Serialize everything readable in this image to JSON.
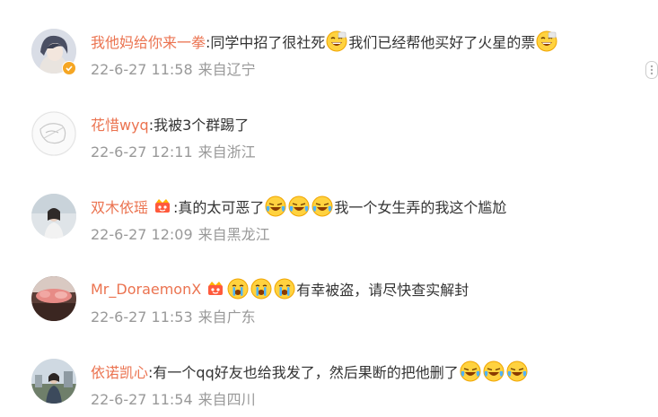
{
  "comments": [
    {
      "username": "我他妈给你来一拳",
      "segments": [
        {
          "type": "text",
          "value": ":同学中招了很社死"
        },
        {
          "type": "emoji",
          "name": "grin-emoji"
        },
        {
          "type": "text",
          "value": "我们已经帮他买好了火星的票"
        },
        {
          "type": "emoji",
          "name": "grin-emoji"
        }
      ],
      "time": "22-6-27 11:58",
      "location": "来自辽宁",
      "verified": true
    },
    {
      "username": "花惜wyq",
      "segments": [
        {
          "type": "text",
          "value": ":我被3个群踢了"
        }
      ],
      "time": "22-6-27 12:11",
      "location": "来自浙江",
      "verified": false
    },
    {
      "username": "双木依瑶",
      "segments": [
        {
          "type": "crown"
        },
        {
          "type": "text",
          "value": ":真的太可恶了"
        },
        {
          "type": "emoji",
          "name": "laugh-cry-emoji"
        },
        {
          "type": "emoji",
          "name": "laugh-cry-emoji"
        },
        {
          "type": "emoji",
          "name": "laugh-cry-emoji"
        },
        {
          "type": "text",
          "value": " 我一个女生弄的我这个尴尬"
        }
      ],
      "time": "22-6-27 12:09",
      "location": "来自黑龙江",
      "verified": false
    },
    {
      "username": "Mr_DoraemonX",
      "segments": [
        {
          "type": "crown"
        },
        {
          "type": "emoji",
          "name": "cry-emoji"
        },
        {
          "type": "emoji",
          "name": "cry-emoji"
        },
        {
          "type": "emoji",
          "name": "cry-emoji"
        },
        {
          "type": "text",
          "value": "有幸被盗，请尽快查实解封"
        }
      ],
      "time": "22-6-27 11:53",
      "location": "来自广东",
      "verified": false
    },
    {
      "username": "依诺凯心",
      "segments": [
        {
          "type": "text",
          "value": ":有一个qq好友也给我发了，然后果断的把他删了"
        },
        {
          "type": "emoji",
          "name": "laugh-cry-emoji"
        },
        {
          "type": "emoji",
          "name": "laugh-cry-emoji"
        },
        {
          "type": "emoji",
          "name": "laugh-cry-emoji"
        }
      ],
      "time": "22-6-27 11:54",
      "location": "来自四川",
      "verified": false
    }
  ],
  "colors": {
    "username": "#eb7350",
    "text": "#333333",
    "meta": "#999999",
    "verified_badge": "#f5a623"
  }
}
